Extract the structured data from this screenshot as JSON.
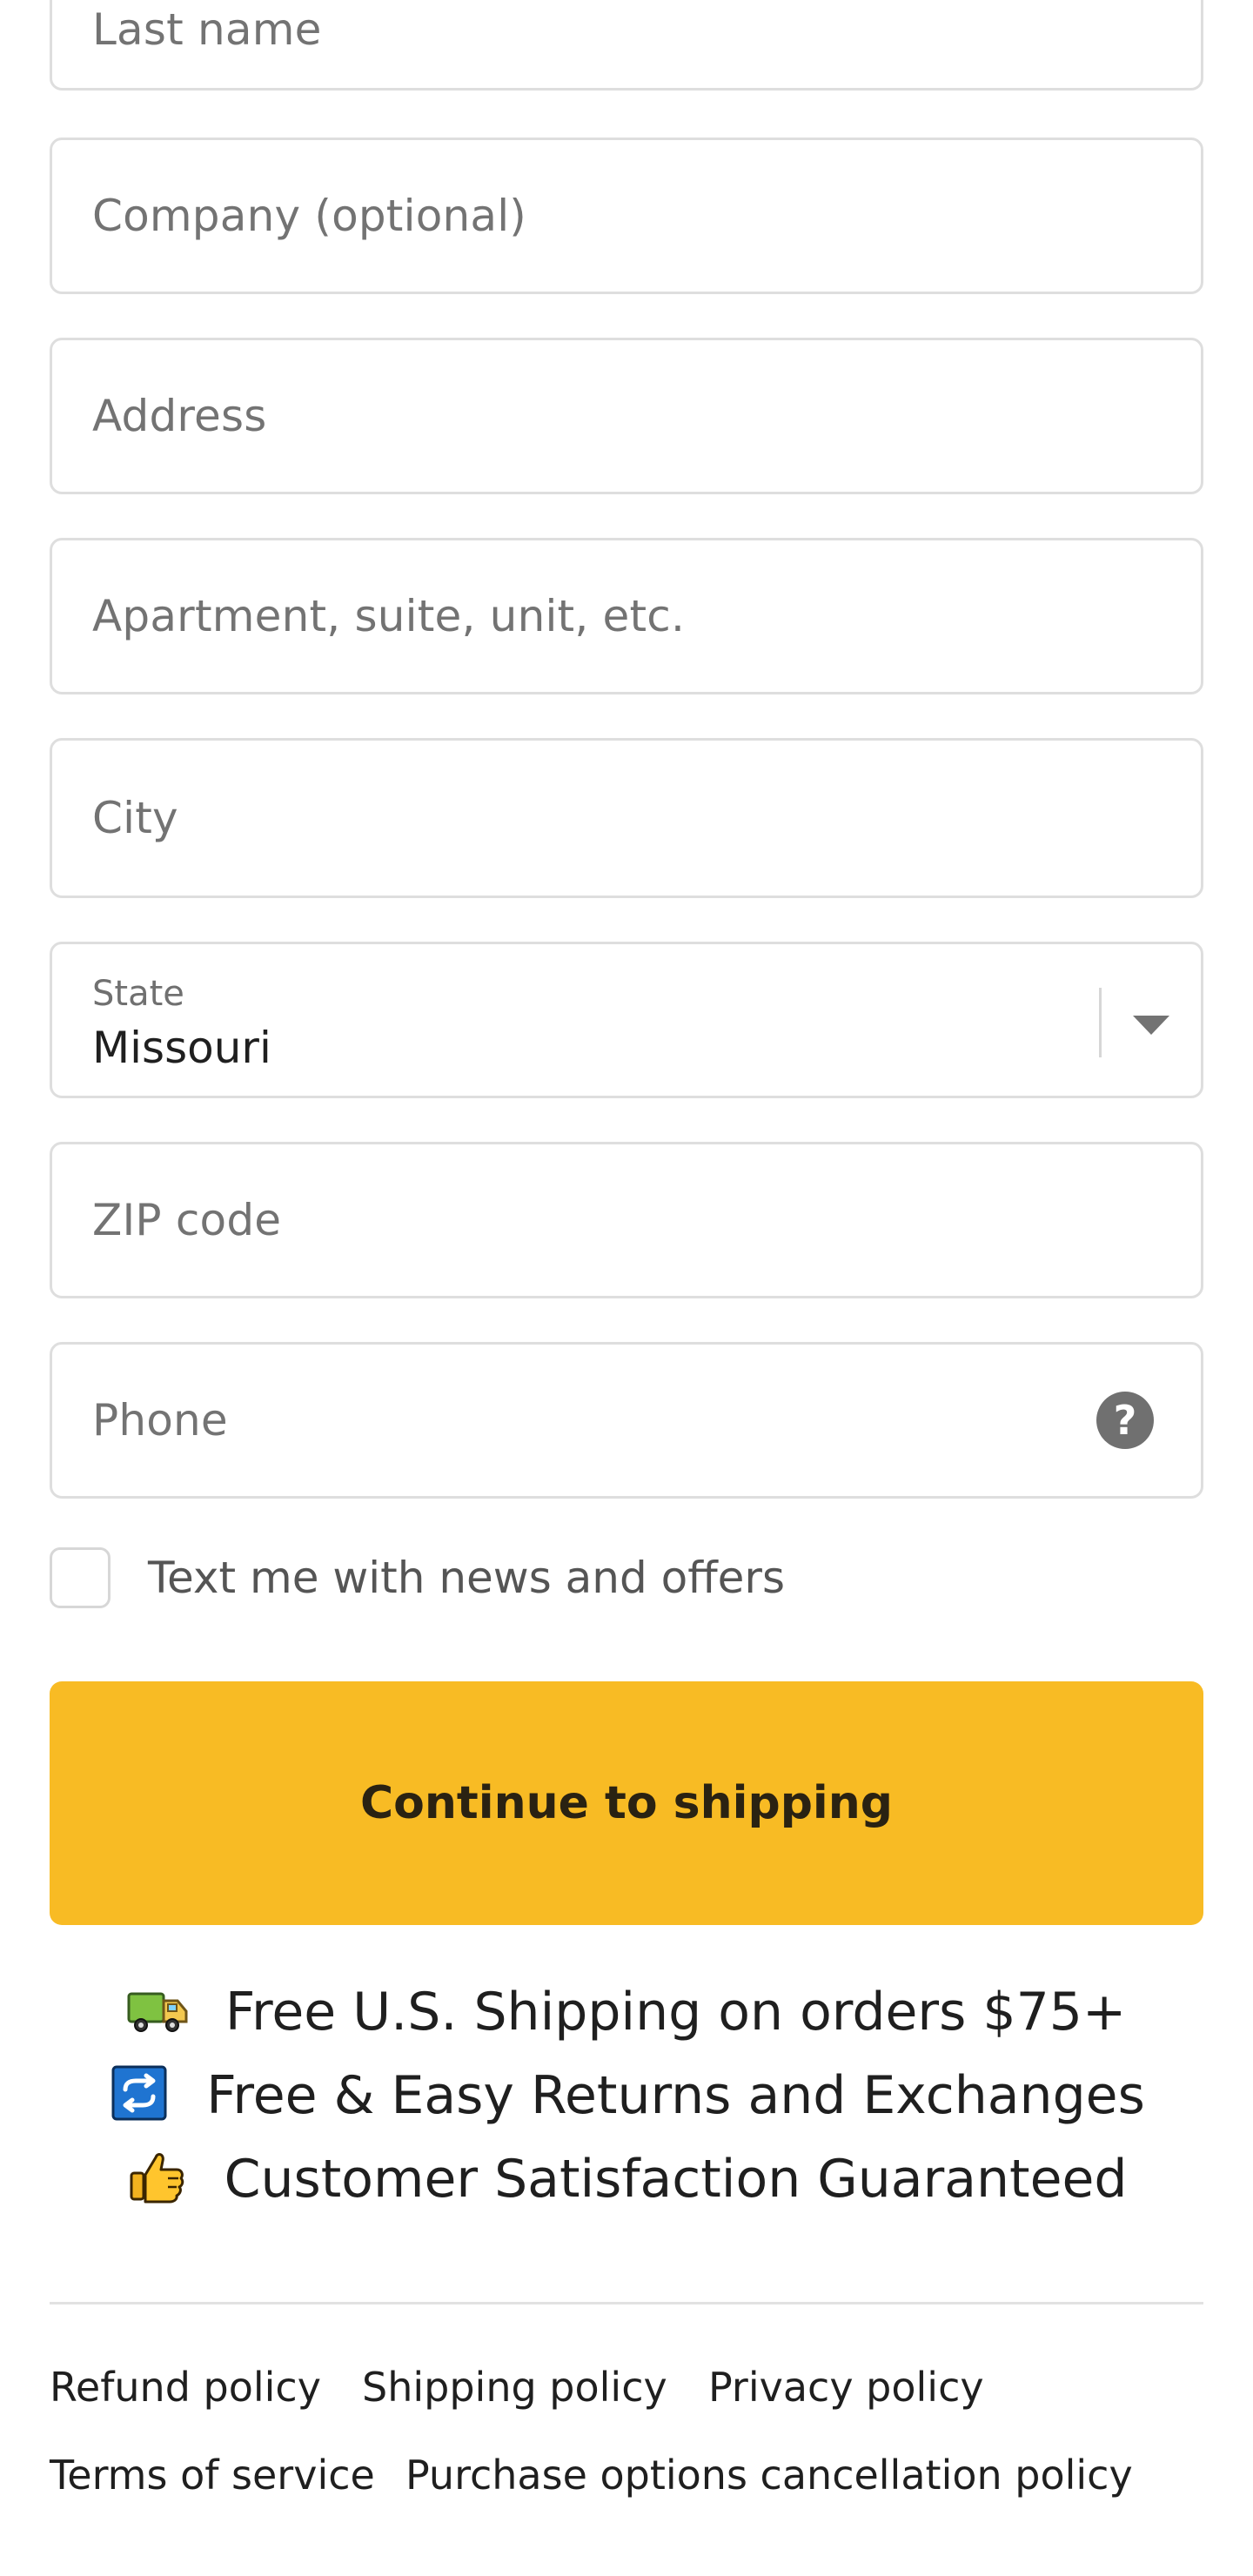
{
  "form": {
    "last_name_placeholder": "Last name",
    "company_placeholder": "Company (optional)",
    "address_placeholder": "Address",
    "apartment_placeholder": "Apartment, suite, unit, etc.",
    "city_placeholder": "City",
    "state": {
      "label": "State",
      "value": "Missouri"
    },
    "zip_placeholder": "ZIP code",
    "phone": {
      "placeholder": "Phone",
      "help_icon_text": "?"
    },
    "text_offers_label": "Text me with news and offers",
    "submit_label": "Continue to shipping"
  },
  "benefits": [
    {
      "icon": "truck-icon",
      "text": "Free U.S. Shipping on orders $75+"
    },
    {
      "icon": "repeat-icon",
      "text": "Free & Easy Returns and Exchanges"
    },
    {
      "icon": "thumbs-up-icon",
      "text": "Customer Satisfaction Guaranteed"
    }
  ],
  "footer": {
    "links": [
      "Refund policy",
      "Shipping policy",
      "Privacy policy",
      "Terms of service",
      "Purchase options cancellation policy"
    ]
  },
  "colors": {
    "accent_button": "#f8bb24",
    "input_border": "#dedede",
    "placeholder_text": "#737373"
  }
}
